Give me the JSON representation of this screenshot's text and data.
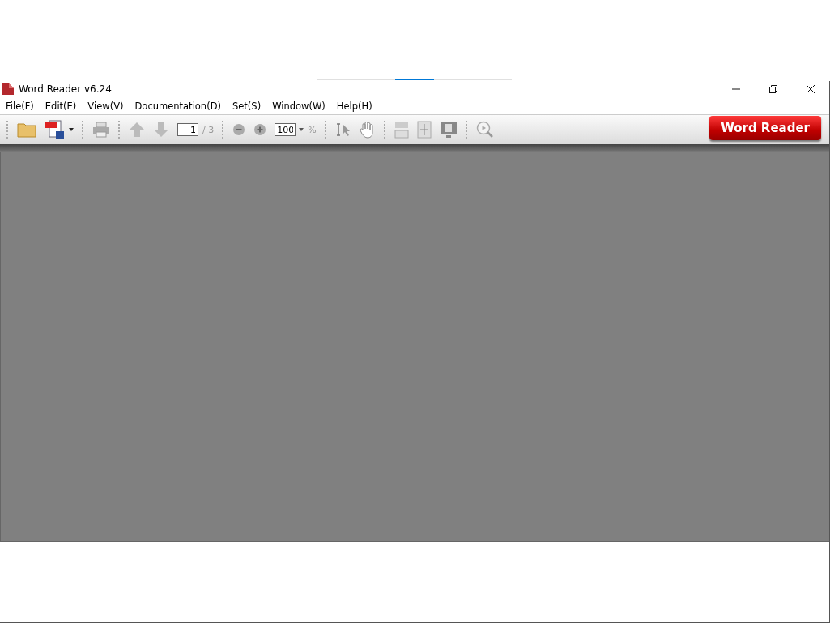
{
  "window": {
    "title": "Word Reader v6.24"
  },
  "menu": [
    "File(F)",
    "Edit(E)",
    "View(V)",
    "Documentation(D)",
    "Set(S)",
    "Window(W)",
    "Help(H)"
  ],
  "toolbar": {
    "page_field": {
      "value": "1"
    },
    "page_total": "/ 3",
    "zoom_field": {
      "value": "100"
    },
    "zoom_unit": "%",
    "brand_button": "Word Reader"
  }
}
